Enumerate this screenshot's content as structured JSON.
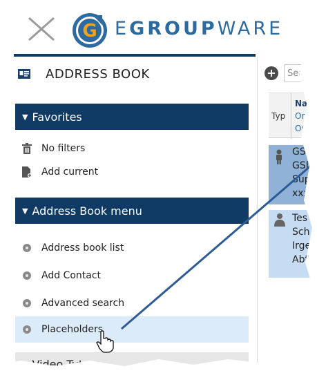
{
  "header": {
    "brand_prefix": "E",
    "brand_bold": "GROUP",
    "brand_suffix": "WARE",
    "logo_letter": "G"
  },
  "sidebar": {
    "app_title": "ADDRESS BOOK",
    "favorites": {
      "heading": "Favorites",
      "items": [
        {
          "label": "No filters",
          "icon": "trash-icon"
        },
        {
          "label": "Add current",
          "icon": "add-document-icon"
        }
      ]
    },
    "menu": {
      "heading": "Address Book menu",
      "items": [
        {
          "label": "Address book list",
          "icon": "bullet-icon"
        },
        {
          "label": "Add Contact",
          "icon": "bullet-icon"
        },
        {
          "label": "Advanced search",
          "icon": "bullet-icon"
        },
        {
          "label": "Placeholders",
          "icon": "bullet-icon",
          "highlighted": true
        }
      ]
    },
    "video": {
      "heading": "Video Tut"
    }
  },
  "right": {
    "search_placeholder": "Sea",
    "columns": {
      "type": "Typ",
      "name": "Nan",
      "org": "Org",
      "owner": "Own"
    },
    "rows": [
      {
        "lines": [
          "GSD",
          "GSD",
          "Sup",
          "xxx"
        ],
        "icon": "person-icon"
      },
      {
        "lines": [
          "Tes",
          "Sch",
          "Irge",
          "Abt"
        ],
        "icon": "group-person-icon"
      }
    ]
  },
  "colors": {
    "accent_dark": "#0f3a63",
    "brand_blue": "#2c6aa0",
    "logo_orange": "#f0a21a",
    "highlight": "#dcebfa",
    "row_selected": "#8fb2d6",
    "row_light": "#c6dcf2"
  }
}
